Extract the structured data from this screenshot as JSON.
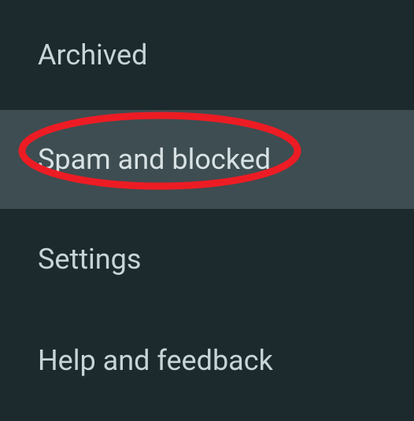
{
  "menu": {
    "items": [
      {
        "label": "Archived",
        "highlighted": false
      },
      {
        "label": "Spam and blocked",
        "highlighted": true,
        "annotated": true
      },
      {
        "label": "Settings",
        "highlighted": false
      },
      {
        "label": "Help and feedback",
        "highlighted": false
      }
    ]
  },
  "colors": {
    "background": "#1c2a2e",
    "highlight": "#3e4d51",
    "text": "#c8d4d6",
    "annotation": "#ed1c24"
  }
}
